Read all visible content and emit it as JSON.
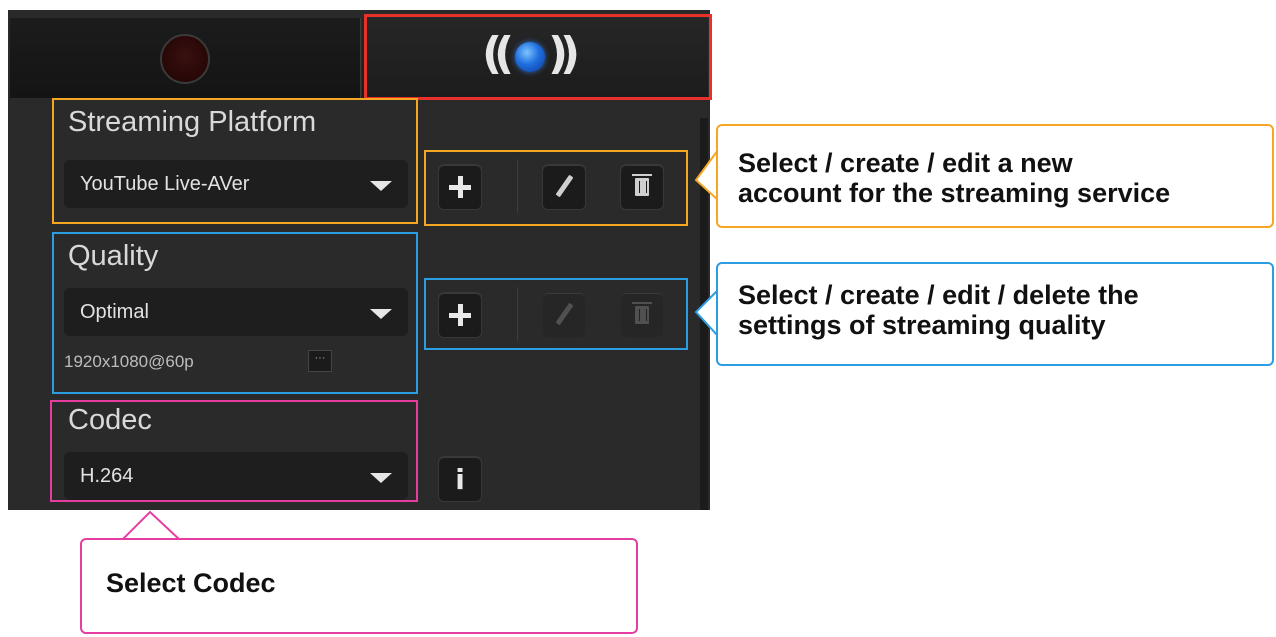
{
  "tabs": [
    {
      "name": "record",
      "icon": "record-icon"
    },
    {
      "name": "streaming",
      "icon": "broadcast-icon",
      "selected": true
    }
  ],
  "streaming_platform": {
    "label": "Streaming Platform",
    "selected": "YouTube Live-AVer"
  },
  "quality": {
    "label": "Quality",
    "selected": "Optimal",
    "resolution": "1920x1080@60p",
    "more": "···"
  },
  "codec": {
    "label": "Codec",
    "selected": "H.264"
  },
  "callouts": {
    "platform_line1": "Select / create / edit a new",
    "platform_line2": "account for the streaming service",
    "quality_line1": "Select / create / edit / delete the",
    "quality_line2": "settings of streaming quality",
    "codec": "Select Codec"
  },
  "colors": {
    "highlight_tab": "#e8312a",
    "highlight_platform": "#f5a623",
    "highlight_quality": "#2b9de0",
    "highlight_codec": "#e63ea0"
  }
}
